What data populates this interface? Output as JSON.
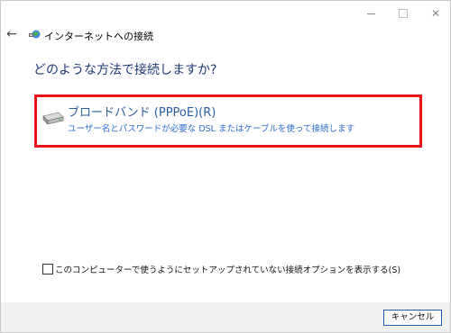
{
  "window": {
    "title": "インターネットへの接続",
    "controls": {
      "minimize": "minimize-icon",
      "maximize": "maximize-icon",
      "close_glyph": "✕"
    },
    "back_glyph": "←"
  },
  "main": {
    "question": "どのような方法で接続しますか?",
    "option": {
      "icon": "broadband-drive-icon",
      "title": "ブロードバンド (PPPoE)(R)",
      "description": "ユーザー名とパスワードが必要な DSL またはケーブルを使って接続します",
      "highlight_color": "#e8121b"
    },
    "checkbox": {
      "checked": false,
      "label": "このコンピューターで使うようにセットアップされていない接続オプションを表示する(S)"
    }
  },
  "footer": {
    "cancel_label": "キャンセル"
  },
  "colors": {
    "question": "#1e3a78",
    "link": "#2b5ea0",
    "footer_bg": "#f0f0f0",
    "button_border": "#1a5fb4"
  }
}
